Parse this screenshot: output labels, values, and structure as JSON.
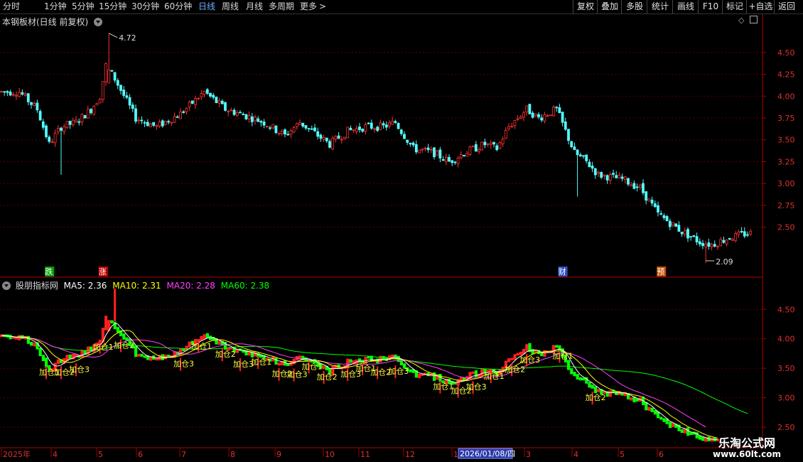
{
  "toolbar": {
    "periods": [
      "分时",
      "1分钟",
      "5分钟",
      "15分钟",
      "30分钟",
      "60分钟",
      "日线",
      "周线",
      "月线",
      "多周期",
      "更多"
    ],
    "active_period": "日线",
    "more_arrow": ">",
    "buttons": [
      "复权",
      "叠加",
      "多股",
      "统计",
      "画线",
      "F10",
      "标记",
      "+自选",
      "返回"
    ]
  },
  "main_panel": {
    "title": "本钢板材(日线 前复权)",
    "high_marker": "4.72",
    "low_marker": "2.09",
    "y_ticks": [
      "4.50",
      "4.25",
      "4.00",
      "3.75",
      "3.50",
      "3.25",
      "3.00",
      "2.75",
      "2.50"
    ],
    "event_tags": [
      {
        "text": "跌",
        "color": "#00a000",
        "index": 16
      },
      {
        "text": "涨",
        "color": "#c00000",
        "index": 34
      },
      {
        "text": "财",
        "color": "#3050c0",
        "index": 188
      },
      {
        "text": "预",
        "color": "#c05000",
        "index": 221
      }
    ]
  },
  "indicator_panel": {
    "name": "股朋指标网",
    "ma_labels": [
      {
        "text": "MA5: 2.36",
        "color": "#ffffff"
      },
      {
        "text": "MA10: 2.31",
        "color": "#ffff00"
      },
      {
        "text": "MA20: 2.28",
        "color": "#ff40ff"
      },
      {
        "text": "MA60: 2.38",
        "color": "#00ff00"
      }
    ],
    "y_ticks": [
      "4.50",
      "4.00",
      "3.50",
      "3.00",
      "2.50"
    ],
    "signal_text": "加仓1",
    "signal_variants": [
      "加仓1",
      "加仓2",
      "加仓3"
    ]
  },
  "time_axis": {
    "labels": [
      "2025年",
      "4",
      "5",
      "6",
      "7",
      "8",
      "9",
      "10",
      "11",
      "12",
      "1",
      "2026/01/08/四",
      "3",
      "4",
      "5",
      "6"
    ],
    "highlight": "2026/01/08/四"
  },
  "watermark": {
    "line1": "乐淘公式网",
    "line2": "www.60lt.com"
  },
  "colors": {
    "up": "#ff3232",
    "down": "#54fcfc",
    "ind_up": "#ff2020",
    "ind_down": "#00ff00",
    "axis_red": "#b00000",
    "ma5": "#ffffff",
    "ma10": "#ffff00",
    "ma20": "#ff40ff",
    "ma60": "#00ff00"
  },
  "chart_data": {
    "type": "candlestick",
    "title": "本钢板材(日线 前复权)",
    "ylim": [
      2.0,
      4.8
    ],
    "price_path": [
      [
        0,
        4.05
      ],
      [
        6,
        4.05
      ],
      [
        12,
        3.85
      ],
      [
        16,
        3.45
      ],
      [
        20,
        3.65
      ],
      [
        25,
        3.7
      ],
      [
        30,
        3.85
      ],
      [
        33,
        4.0
      ],
      [
        35,
        4.35
      ],
      [
        38,
        4.2
      ],
      [
        45,
        3.75
      ],
      [
        52,
        3.65
      ],
      [
        60,
        3.8
      ],
      [
        68,
        4.05
      ],
      [
        75,
        3.85
      ],
      [
        80,
        3.8
      ],
      [
        88,
        3.7
      ],
      [
        95,
        3.55
      ],
      [
        100,
        3.7
      ],
      [
        106,
        3.55
      ],
      [
        110,
        3.45
      ],
      [
        116,
        3.6
      ],
      [
        122,
        3.65
      ],
      [
        128,
        3.65
      ],
      [
        132,
        3.7
      ],
      [
        138,
        3.4
      ],
      [
        145,
        3.35
      ],
      [
        150,
        3.25
      ],
      [
        155,
        3.35
      ],
      [
        162,
        3.45
      ],
      [
        166,
        3.4
      ],
      [
        170,
        3.65
      ],
      [
        176,
        3.85
      ],
      [
        180,
        3.75
      ],
      [
        186,
        3.85
      ],
      [
        192,
        3.35
      ],
      [
        196,
        3.25
      ],
      [
        200,
        3.1
      ],
      [
        208,
        3.05
      ],
      [
        214,
        2.95
      ],
      [
        220,
        2.65
      ],
      [
        228,
        2.45
      ],
      [
        234,
        2.33
      ],
      [
        238,
        2.3
      ],
      [
        244,
        2.38
      ],
      [
        250,
        2.43
      ]
    ],
    "high": 4.72,
    "low": 2.09
  }
}
